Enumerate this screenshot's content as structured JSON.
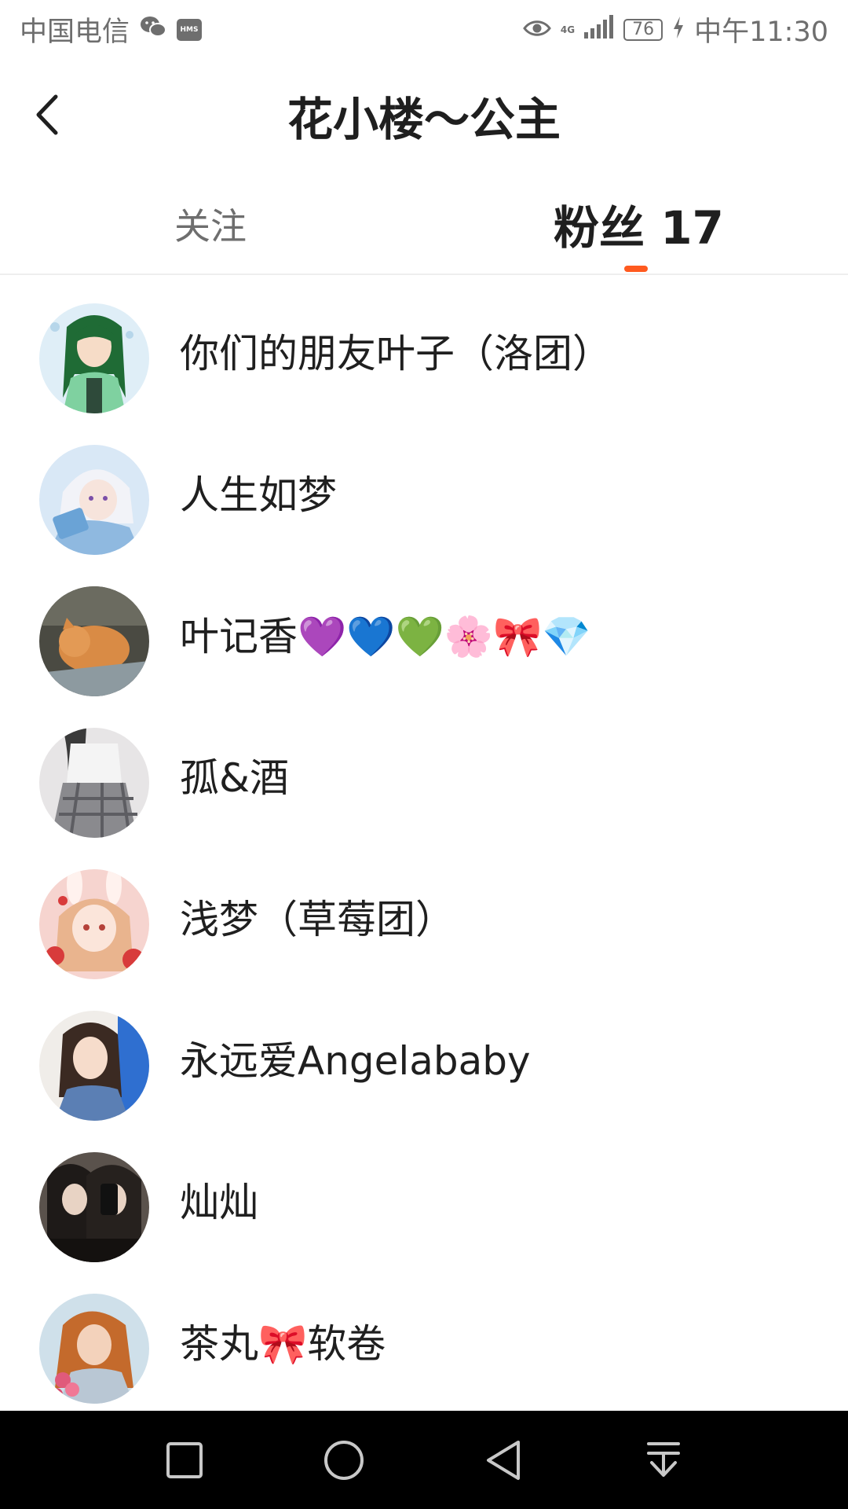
{
  "status_bar": {
    "carrier": "中国电信",
    "hms_label": "HMS",
    "network": "4G",
    "battery": "76",
    "time": "中午11:30"
  },
  "header": {
    "title": "花小楼～公主"
  },
  "tabs": {
    "follow_label": "关注",
    "fans_label": "粉丝 17",
    "active": "fans"
  },
  "colors": {
    "accent": "#ff5a1f",
    "text": "#1f1f1f",
    "muted": "#6e6e6e",
    "navbar": "#000000"
  },
  "fans": [
    {
      "name": "你们的朋友叶子（洛团）",
      "avatar": "anime-green-hair-avatar"
    },
    {
      "name": "人生如梦",
      "avatar": "anime-white-hair-avatar"
    },
    {
      "name": "叶记香💜💙💚🌸🎀💎",
      "avatar": "cat-avatar"
    },
    {
      "name": "孤&酒",
      "avatar": "girl-uniform-avatar"
    },
    {
      "name": "浅梦（草莓团）",
      "avatar": "anime-bunny-avatar"
    },
    {
      "name": "永远爱Angelababy",
      "avatar": "woman-portrait-avatar"
    },
    {
      "name": "灿灿",
      "avatar": "girls-selfie-avatar"
    },
    {
      "name": "茶丸🎀软卷",
      "avatar": "woman-flowers-avatar"
    }
  ],
  "nav_bar": {
    "buttons": [
      "recent-apps",
      "home",
      "back",
      "notifications"
    ]
  }
}
